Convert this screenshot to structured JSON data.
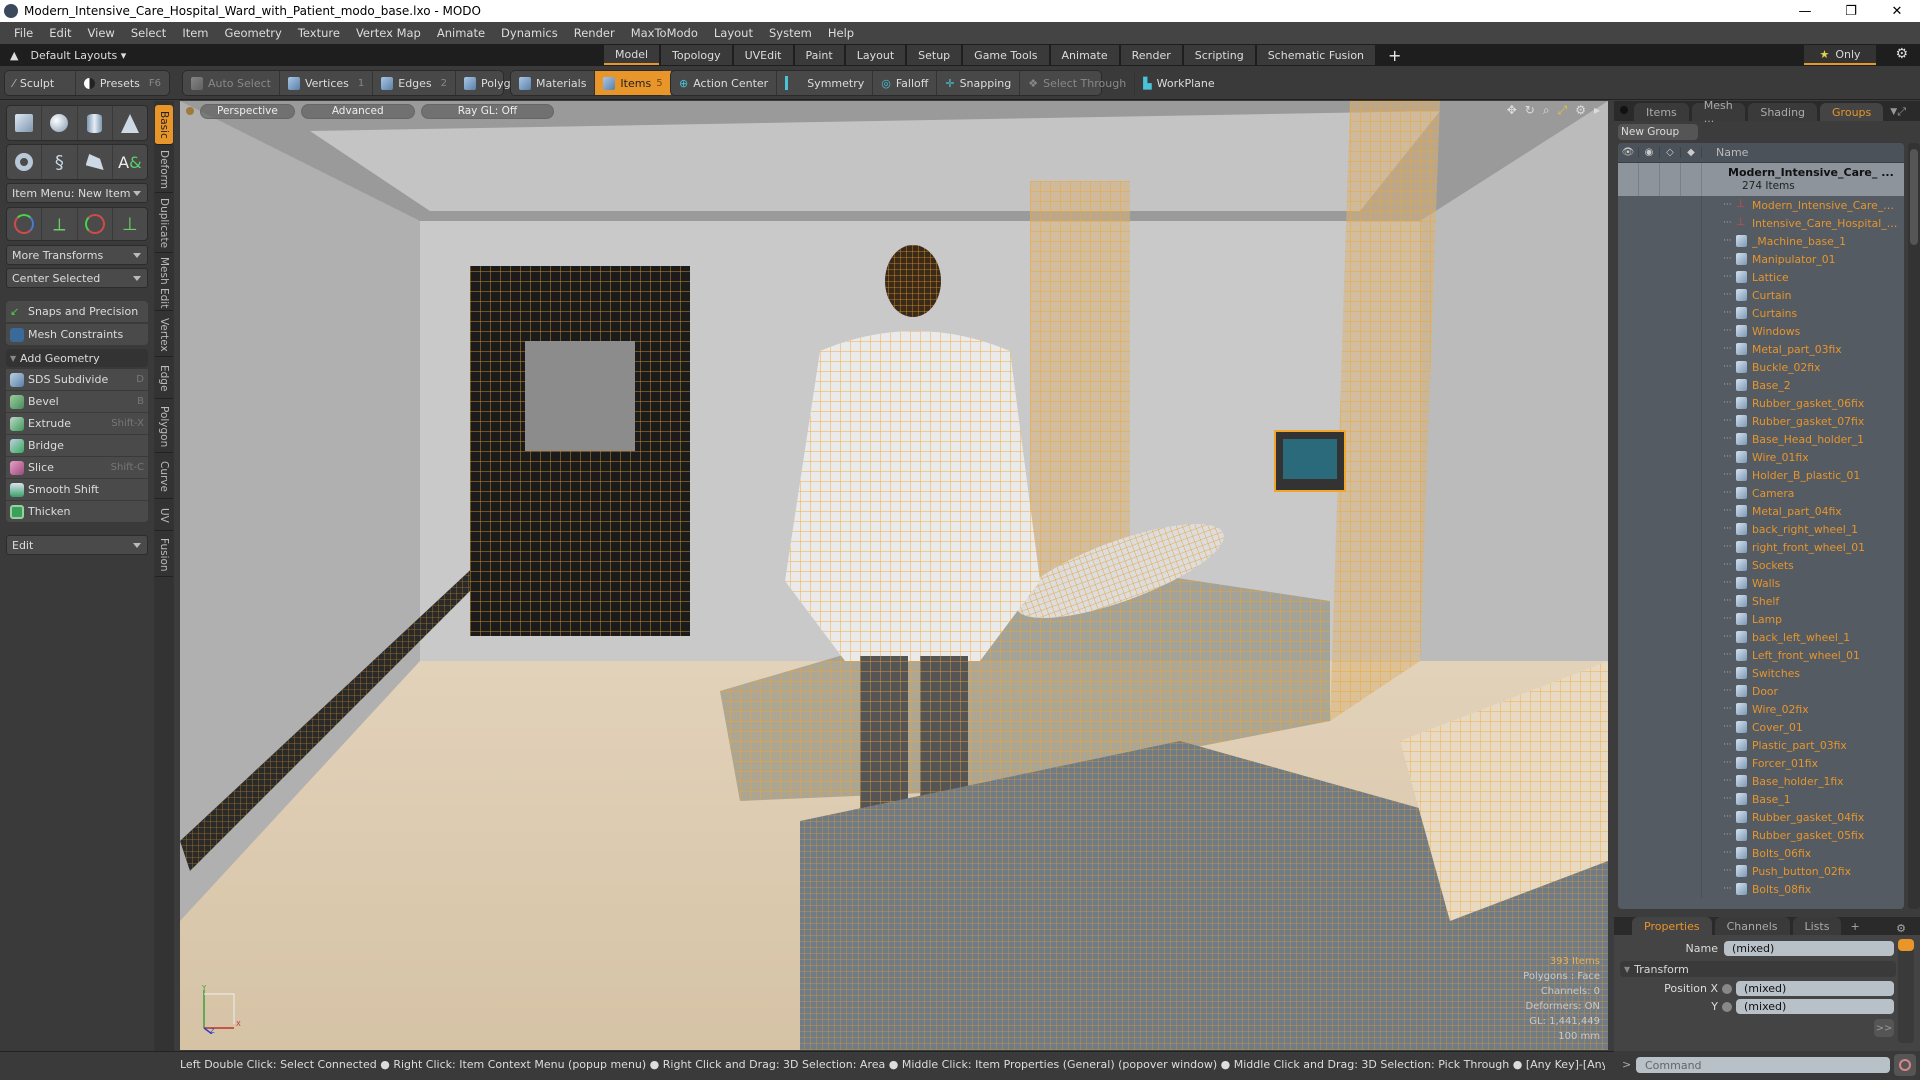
{
  "window": {
    "title": "Modern_Intensive_Care_Hospital_Ward_with_Patient_modo_base.lxo - MODO",
    "controls": {
      "minimize": "—",
      "restore": "❐",
      "close": "✕"
    }
  },
  "menu": [
    "File",
    "Edit",
    "View",
    "Select",
    "Item",
    "Geometry",
    "Texture",
    "Vertex Map",
    "Animate",
    "Dynamics",
    "Render",
    "MaxToModo",
    "Layout",
    "System",
    "Help"
  ],
  "layout_bar": {
    "layouts_label": "Default Layouts ▾",
    "tabs": [
      "Model",
      "Topology",
      "UVEdit",
      "Paint",
      "Layout",
      "Setup",
      "Game Tools",
      "Animate",
      "Render",
      "Scripting",
      "Schematic Fusion"
    ],
    "active_tab": "Model",
    "add_tab": "+",
    "only_label": "Only",
    "star": "★",
    "gear": "⚙"
  },
  "toolbar": {
    "sculpt": "Sculpt",
    "presets": "Presets",
    "presets_key": "F6",
    "auto_select": "Auto Select",
    "vertices": "Vertices",
    "vertices_key": "1",
    "edges": "Edges",
    "edges_key": "2",
    "polygons": "Polygons",
    "materials": "Materials",
    "items": "Items",
    "items_key": "5",
    "action_center": "Action Center",
    "symmetry": "Symmetry",
    "falloff": "Falloff",
    "snapping": "Snapping",
    "select_through": "Select Through",
    "workplane": "WorkPlane"
  },
  "left_panel": {
    "item_menu": "Item Menu: New Item",
    "more_transforms": "More Transforms",
    "center_selected": "Center Selected",
    "snaps": "Snaps and Precision",
    "mesh_constraints": "Mesh Constraints",
    "add_geometry": "Add Geometry",
    "tools": [
      {
        "label": "SDS Subdivide",
        "key": "D"
      },
      {
        "label": "Bevel",
        "key": "B"
      },
      {
        "label": "Extrude",
        "key": "Shift-X"
      },
      {
        "label": "Bridge",
        "key": ""
      },
      {
        "label": "Slice",
        "key": "Shift-C"
      },
      {
        "label": "Smooth Shift",
        "key": ""
      },
      {
        "label": "Thicken",
        "key": ""
      }
    ],
    "edit": "Edit",
    "vertical_tabs": [
      "Basic",
      "Deform",
      "Duplicate",
      "Mesh Edit",
      "Vertex",
      "Edge",
      "Polygon",
      "Curve",
      "UV",
      "Fusion"
    ],
    "active_vertical_tab": "Basic"
  },
  "viewport": {
    "view": "Perspective",
    "shading": "Advanced",
    "raygl": "Ray GL: Off",
    "hud": {
      "items": "393 Items",
      "polygons": "Polygons : Face",
      "channels": "Channels: 0",
      "deformers": "Deformers: ON",
      "gl": "GL: 1,441,449",
      "units": "100 mm"
    },
    "axis": {
      "x": "X",
      "y": "Y",
      "z": "Z"
    },
    "accent_color": "#f2a52a"
  },
  "right_panel": {
    "tabs": [
      "Items",
      "Mesh ...",
      "Shading",
      "Groups"
    ],
    "active_tab": "Groups",
    "new_group": "New Group",
    "column_name": "Name",
    "root": {
      "name": "Modern_Intensive_Care_ ...",
      "count": "274 Items"
    },
    "items": [
      "Modern_Intensive_Care_Ho...",
      "Intensive_Care_Hospital_W...",
      "_Machine_base_1",
      "Manipulator_01",
      "Lattice",
      "Curtain",
      "Curtains",
      "Windows",
      "Metal_part_03fix",
      "Buckle_02fix",
      "Base_2",
      "Rubber_gasket_06fix",
      "Rubber_gasket_07fix",
      "Base_Head_holder_1",
      "Wire_01fix",
      "Holder_B_plastic_01",
      "Camera",
      "Metal_part_04fix",
      "back_right_wheel_1",
      "right_front_wheel_01",
      "Sockets",
      "Walls",
      "Shelf",
      "Lamp",
      "back_left_wheel_1",
      "Left_front_wheel_01",
      "Switches",
      "Door",
      "Wire_02fix",
      "Cover_01",
      "Plastic_part_03fix",
      "Forcer_01fix",
      "Base_holder_1fix",
      "Base_1",
      "Rubber_gasket_04fix",
      "Rubber_gasket_05fix",
      "Bolts_06fix",
      "Push_button_02fix",
      "Bolts_08fix"
    ],
    "props_tabs": [
      "Properties",
      "Channels",
      "Lists"
    ],
    "props_active": "Properties",
    "props_add": "+",
    "name_label": "Name",
    "name_value": "(mixed)",
    "transform_label": "Transform",
    "position_x_label": "Position X",
    "position_x_value": "(mixed)",
    "position_y_label": "Y",
    "position_y_value": "(mixed)",
    "more_button": ">>"
  },
  "statusbar": {
    "hint": "Left Double Click: Select Connected ● Right Click: Item Context Menu (popup menu) ● Right Click and Drag: 3D Selection: Area ● Middle Click: Item Properties (General) (popover window) ● Middle Click and Drag: 3D Selection: Pick Through ● [Any Key]-[Any Button] Click and Drag: dragDrop...",
    "arrow": ">",
    "command_placeholder": "Command"
  }
}
